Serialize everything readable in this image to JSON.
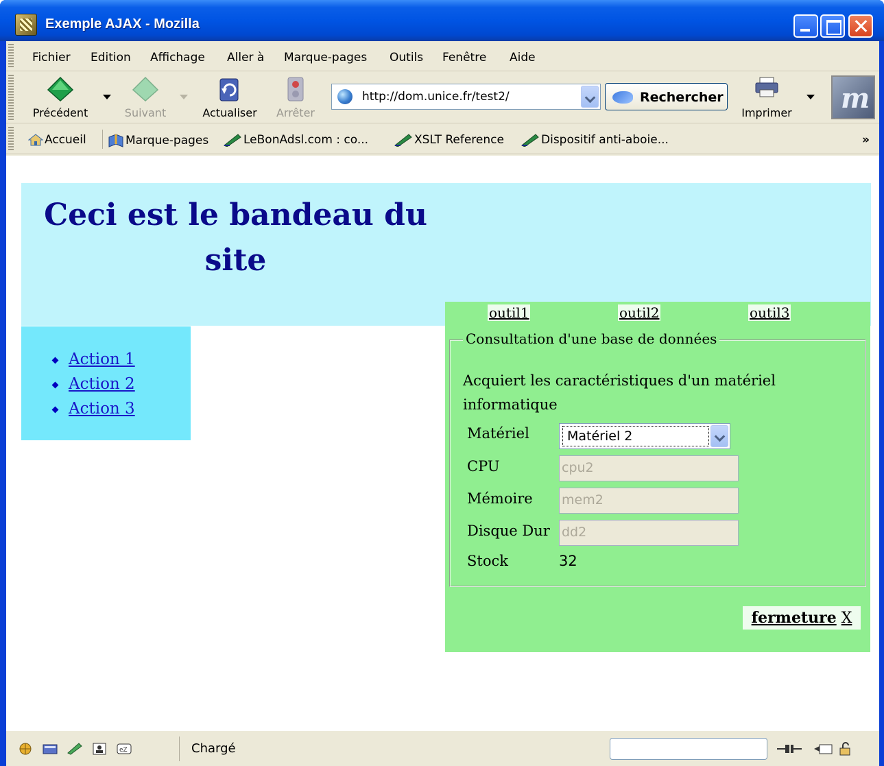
{
  "window": {
    "title": "Exemple AJAX - Mozilla"
  },
  "menubar": {
    "items": [
      "Fichier",
      "Edition",
      "Affichage",
      "Aller à",
      "Marque-pages",
      "Outils",
      "Fenêtre",
      "Aide"
    ]
  },
  "navbar": {
    "back_label": "Précédent",
    "forward_label": "Suivant",
    "reload_label": "Actualiser",
    "stop_label": "Arrêter",
    "url": "http://dom.unice.fr/test2/",
    "search_label": "Rechercher",
    "print_label": "Imprimer"
  },
  "bookmarks": {
    "items": [
      "Accueil",
      "Marque-pages",
      "LeBonAdsl.com : co...",
      "XSLT Reference",
      "Dispositif anti-aboie..."
    ],
    "more": "»"
  },
  "page": {
    "banner_title": "Ceci est le bandeau du site",
    "side_actions": [
      "Action 1",
      "Action 2",
      "Action 3"
    ],
    "tool_links": [
      "outil1",
      "outil2",
      "outil3"
    ],
    "form": {
      "legend": "Consultation d'une base de données",
      "description": "Acquiert les caractéristiques d'un matériel informatique",
      "material_label": "Matériel",
      "material_value": "Matériel 2",
      "cpu_label": "CPU",
      "cpu_value": "cpu2",
      "memory_label": "Mémoire",
      "memory_value": "mem2",
      "disk_label": "Disque Dur",
      "disk_value": "dd2",
      "stock_label": "Stock",
      "stock_value": "32"
    },
    "close_label": "fermeture",
    "close_x": "X"
  },
  "statusbar": {
    "status": "Chargé"
  },
  "colors": {
    "banner_bg": "#c0f4fc",
    "sidemenu_bg": "#74e8fc",
    "tools_bg": "#90ee90",
    "banner_text": "#0a0a8a",
    "link": "#1a16c8"
  }
}
